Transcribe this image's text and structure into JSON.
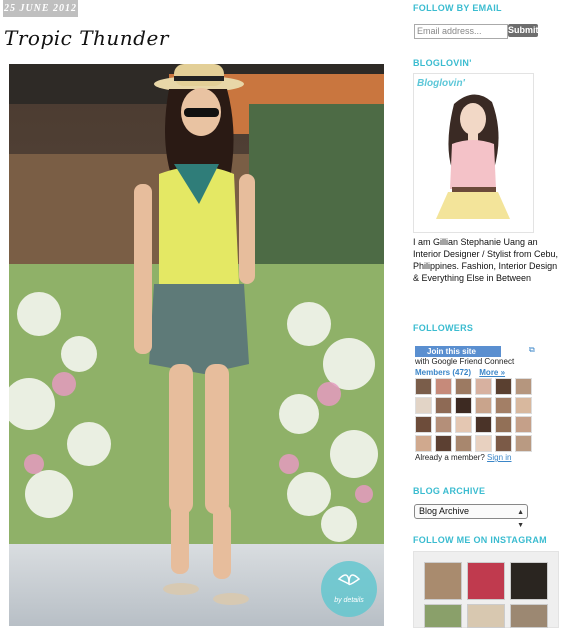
{
  "post": {
    "date": "25 JUNE 2012",
    "title": "Tropic Thunder",
    "watermark": "by details"
  },
  "sidebar": {
    "follow_email": {
      "heading": "FOLLOW BY EMAIL",
      "placeholder": "Email address...",
      "submit_label": "Submit"
    },
    "bloglovin": {
      "heading": "BLOGLOVIN'",
      "logo_text": "Bloglovin'"
    },
    "bio": "I am Gillian Stephanie Uang an Interior Designer / Stylist from Cebu, Philippines. Fashion, Interior Design & Everything Else in Between",
    "followers": {
      "heading": "FOLLOWERS",
      "join_label": "Join this site",
      "with_text": "with Google Friend Connect",
      "members_label": "Members (472)",
      "more_label": "More »",
      "already_text": "Already a member?",
      "sign_in_label": "Sign in"
    },
    "archive": {
      "heading": "BLOG ARCHIVE",
      "selected": "Blog Archive"
    },
    "instagram": {
      "heading": "FOLLOW ME ON INSTAGRAM"
    }
  },
  "colors": {
    "accent": "#3bbcd0",
    "link": "#3b86c8",
    "date_badge": "#bfbfbf"
  }
}
